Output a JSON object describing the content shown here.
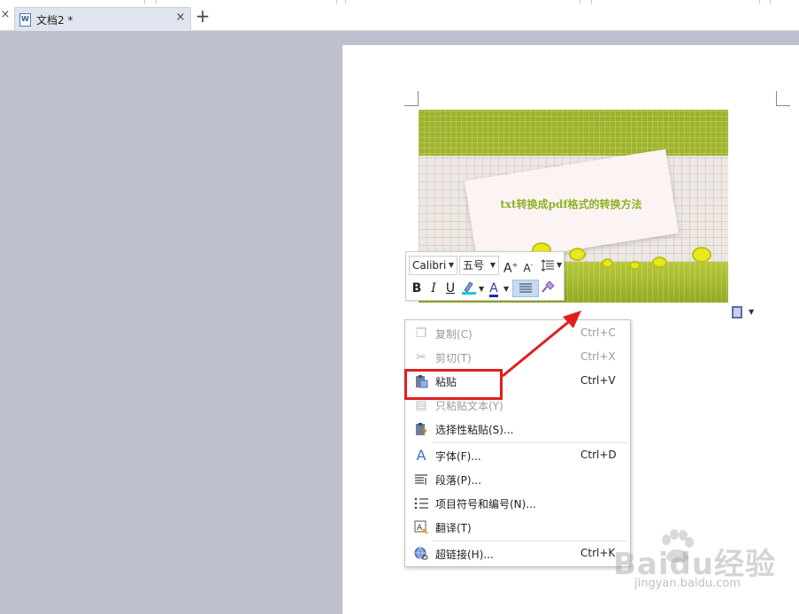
{
  "tabs": {
    "prev_close": "×",
    "active_title": "文档2 *",
    "active_close": "×",
    "new_tab": "+"
  },
  "image": {
    "caption": "txt转换成pdf格式的转换方法"
  },
  "mini_toolbar": {
    "font": "Calibri",
    "size": "五号",
    "grow": "A",
    "shrink": "A",
    "bold": "B",
    "italic": "I",
    "underline": "U",
    "font_color": "A"
  },
  "context_menu": {
    "items": [
      {
        "label": "复制(C)",
        "shortcut": "Ctrl+C",
        "icon": "copy-icon",
        "disabled": true
      },
      {
        "label": "剪切(T)",
        "shortcut": "Ctrl+X",
        "icon": "scissors-icon",
        "disabled": true
      },
      {
        "label": "粘贴",
        "shortcut": "Ctrl+V",
        "icon": "paste-icon",
        "disabled": false
      },
      {
        "label": "只粘贴文本(Y)",
        "shortcut": "",
        "icon": "paste-text-icon",
        "disabled": true
      },
      {
        "label": "选择性粘贴(S)...",
        "shortcut": "",
        "icon": "paste-special-icon",
        "disabled": false
      },
      {
        "label": "字体(F)...",
        "shortcut": "Ctrl+D",
        "icon": "font-icon",
        "disabled": false
      },
      {
        "label": "段落(P)...",
        "shortcut": "",
        "icon": "paragraph-icon",
        "disabled": false
      },
      {
        "label": "项目符号和编号(N)...",
        "shortcut": "",
        "icon": "bullets-icon",
        "disabled": false
      },
      {
        "label": "翻译(T)",
        "shortcut": "",
        "icon": "translate-icon",
        "disabled": false
      },
      {
        "label": "超链接(H)...",
        "shortcut": "Ctrl+K",
        "icon": "hyperlink-icon",
        "disabled": false
      }
    ]
  },
  "watermark": {
    "brand": "Baidu经验",
    "url": "jingyan.baidu.com"
  },
  "colors": {
    "highlight": "#e01e1e",
    "workspace": "#bfc0cf",
    "tab_active": "#dfe4ee"
  }
}
